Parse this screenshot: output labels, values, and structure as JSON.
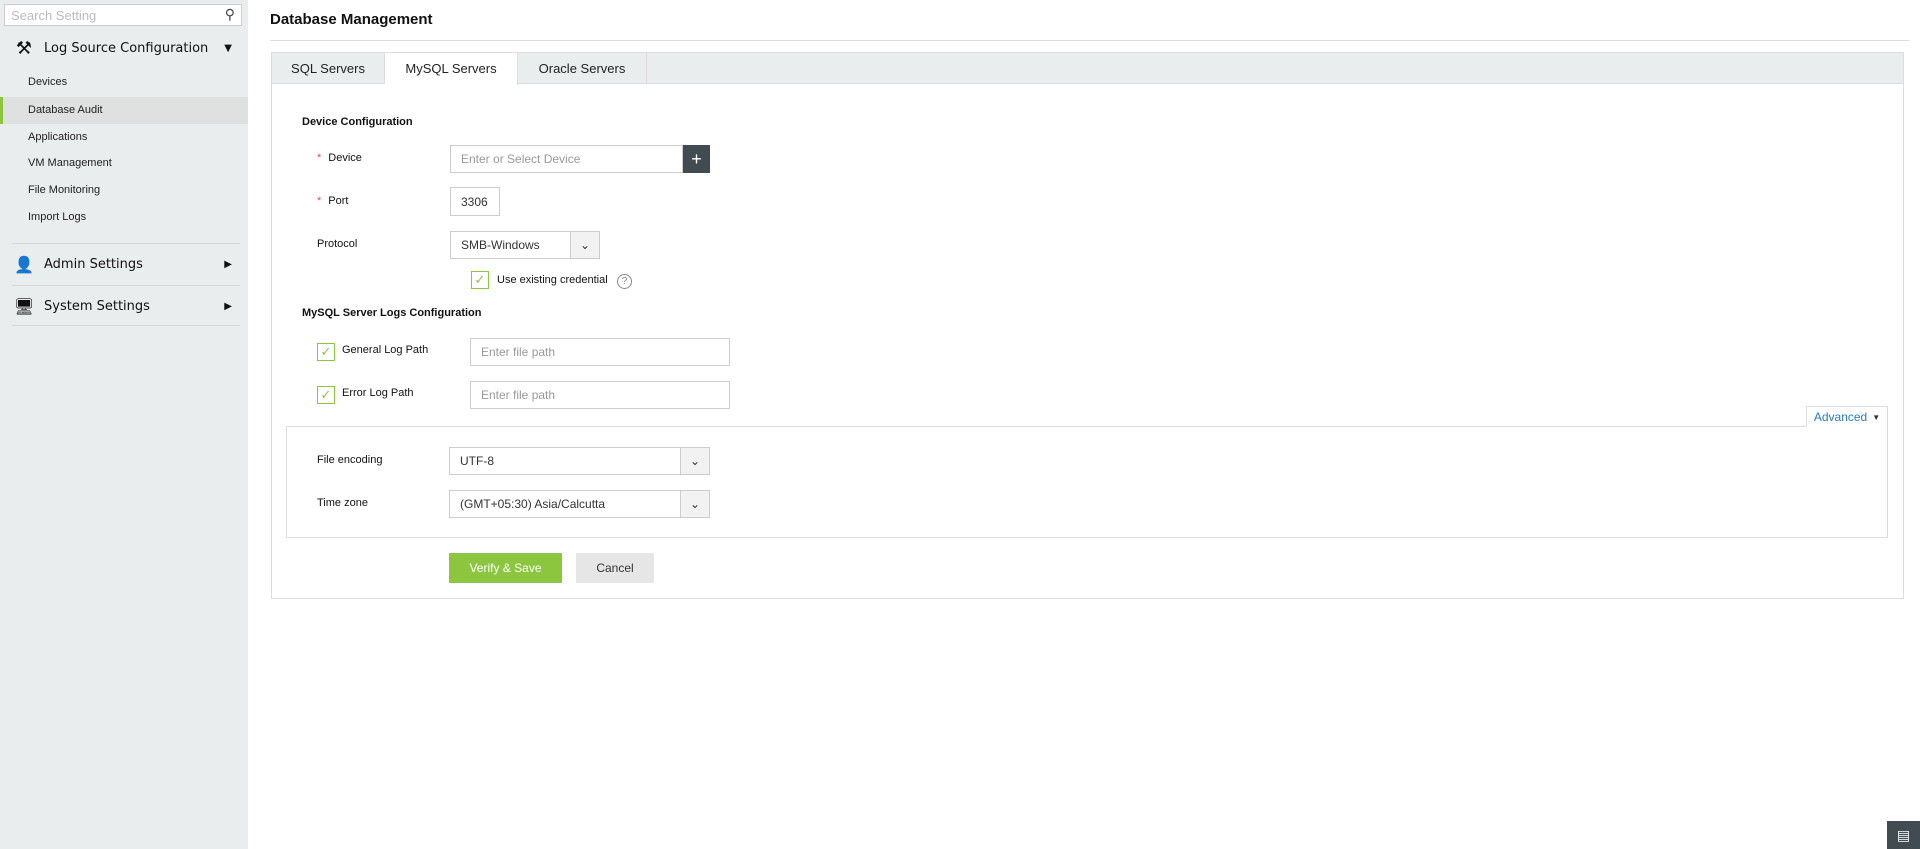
{
  "sidebar": {
    "search_placeholder": "Search Setting",
    "sections": [
      {
        "label": "Log Source Configuration"
      },
      {
        "label": "Admin Settings"
      },
      {
        "label": "System Settings"
      }
    ],
    "items": [
      {
        "label": "Devices"
      },
      {
        "label": "Database Audit"
      },
      {
        "label": "Applications"
      },
      {
        "label": "VM Management"
      },
      {
        "label": "File Monitoring"
      },
      {
        "label": "Import Logs"
      }
    ]
  },
  "header": {
    "title": "Database Management"
  },
  "tabs": [
    {
      "label": "SQL Servers"
    },
    {
      "label": "MySQL Servers"
    },
    {
      "label": "Oracle Servers"
    }
  ],
  "form": {
    "device_config_heading": "Device Configuration",
    "device_label": "Device",
    "device_placeholder": "Enter or Select Device",
    "port_label": "Port",
    "port_value": "3306",
    "protocol_label": "Protocol",
    "protocol_value": "SMB-Windows",
    "use_existing_credential": "Use existing credential",
    "logs_heading": "MySQL Server Logs Configuration",
    "general_log_label": "General Log Path",
    "general_log_placeholder": "Enter file path",
    "error_log_label": "Error Log Path",
    "error_log_placeholder": "Enter file path",
    "advanced_label": "Advanced",
    "file_encoding_label": "File encoding",
    "file_encoding_value": "UTF-8",
    "time_zone_label": "Time zone",
    "time_zone_value": "(GMT+05:30) Asia/Calcutta",
    "required_mark": "*",
    "verify_save": "Verify & Save",
    "cancel": "Cancel"
  },
  "colors": {
    "accent": "#8cc63f",
    "dark_button": "#414b52"
  }
}
